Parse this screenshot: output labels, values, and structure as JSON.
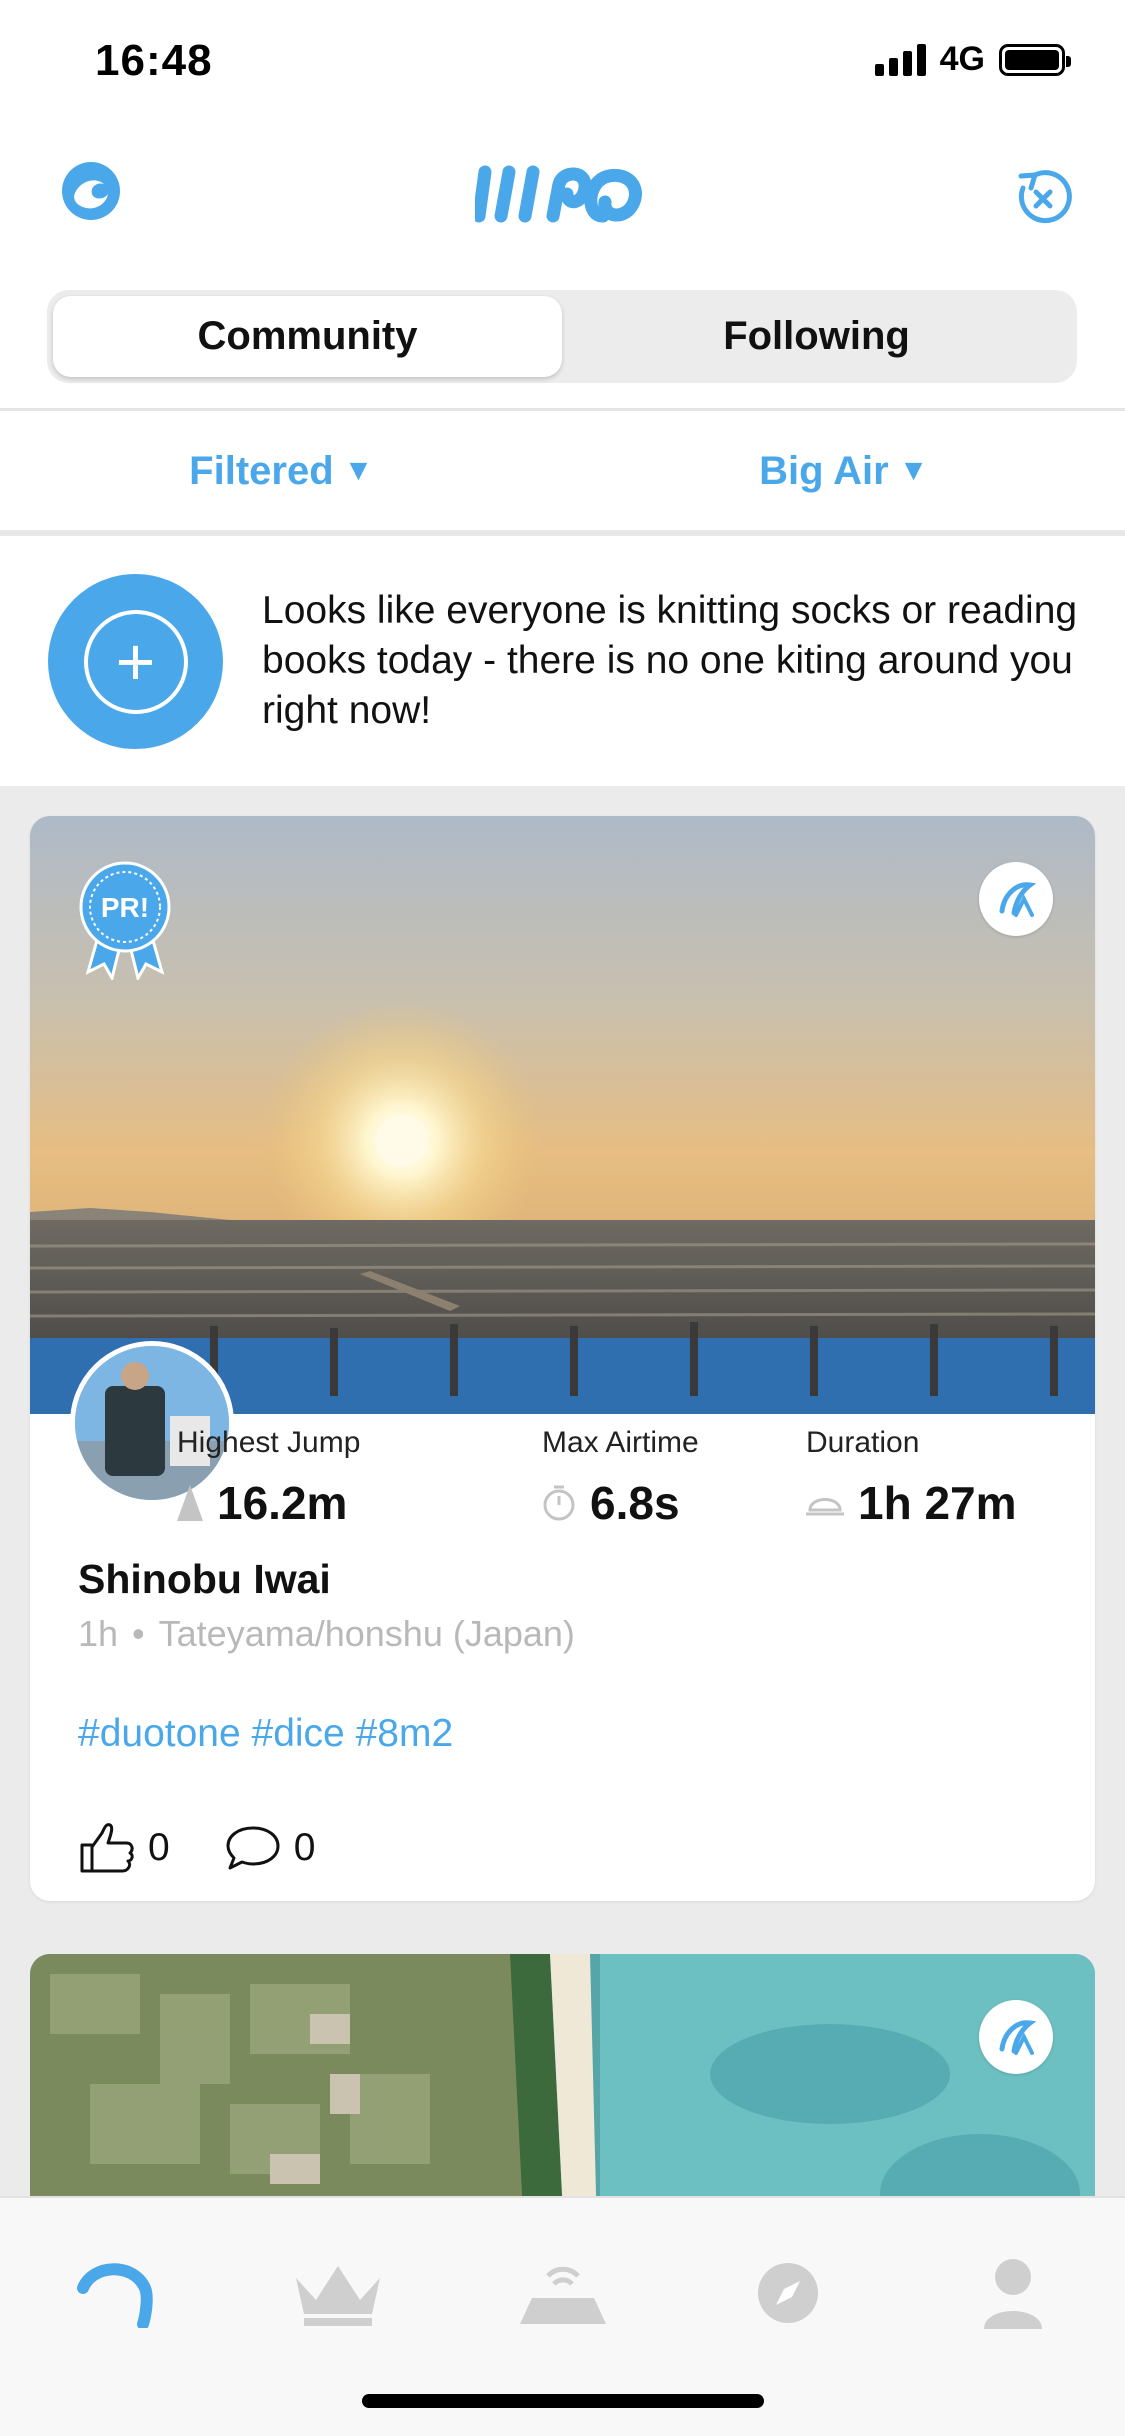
{
  "status_bar": {
    "time": "16:48",
    "network": "4G"
  },
  "header": {
    "left_icon": "wave-icon",
    "logo": "woo-logo",
    "right_icon": "session-reset-icon"
  },
  "segmented": {
    "tabs": [
      {
        "label": "Community",
        "active": true
      },
      {
        "label": "Following",
        "active": false
      }
    ]
  },
  "filters": {
    "left": "Filtered",
    "right": "Big Air"
  },
  "notice": {
    "text": "Looks like everyone is knitting socks or reading books today - there is no one kiting around you right now!"
  },
  "post": {
    "badge": "PR!",
    "username": "Shinobu Iwai",
    "time_ago": "1h",
    "location": "Tateyama/honshu (Japan)",
    "tags": "#duotone #dice #8m2",
    "stats": [
      {
        "label": "Highest Jump",
        "value": "16.2m",
        "icon": "jump-icon"
      },
      {
        "label": "Max Airtime",
        "value": "6.8s",
        "icon": "stopwatch-icon"
      },
      {
        "label": "Duration",
        "value": "1h 27m",
        "icon": "helmet-icon"
      }
    ],
    "likes": "0",
    "comments": "0"
  },
  "tabbar": {
    "items": [
      "kite-icon",
      "crown-icon",
      "spot-icon",
      "compass-icon",
      "profile-icon"
    ],
    "active_color": "#4aa8ea",
    "inactive_color": "#cfcfcf"
  },
  "colors": {
    "accent": "#4aa8ea",
    "muted": "#b8b8b8"
  }
}
